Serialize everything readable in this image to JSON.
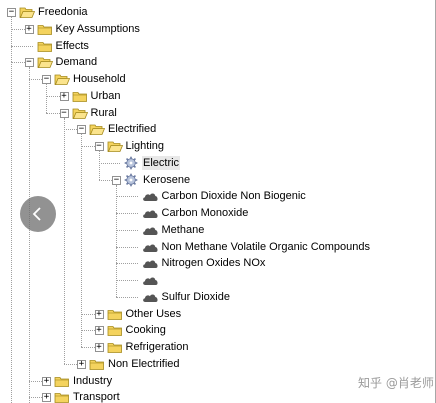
{
  "tree": {
    "nodes": [
      {
        "name": "tree-node-freedonia",
        "label": "Freedonia",
        "depth": 0,
        "row": 0,
        "toggle": "minus",
        "icon": "folder-open-icon"
      },
      {
        "name": "tree-node-key-assumptions",
        "label": "Key Assumptions",
        "depth": 1,
        "row": 1,
        "toggle": "plus",
        "icon": "folder-icon"
      },
      {
        "name": "tree-node-effects",
        "label": "Effects",
        "depth": 1,
        "row": 2,
        "toggle": null,
        "icon": "folder-icon"
      },
      {
        "name": "tree-node-demand",
        "label": "Demand",
        "depth": 1,
        "row": 3,
        "toggle": "minus",
        "icon": "folder-open-icon"
      },
      {
        "name": "tree-node-household",
        "label": "Household",
        "depth": 2,
        "row": 4,
        "toggle": "minus",
        "icon": "folder-open-icon"
      },
      {
        "name": "tree-node-urban",
        "label": "Urban",
        "depth": 3,
        "row": 5,
        "toggle": "plus",
        "icon": "folder-icon"
      },
      {
        "name": "tree-node-rural",
        "label": "Rural",
        "depth": 3,
        "row": 6,
        "toggle": "minus",
        "icon": "folder-open-icon"
      },
      {
        "name": "tree-node-electrified",
        "label": "Electrified",
        "depth": 4,
        "row": 7,
        "toggle": "minus",
        "icon": "folder-open-icon"
      },
      {
        "name": "tree-node-lighting",
        "label": "Lighting",
        "depth": 5,
        "row": 8,
        "toggle": "minus",
        "icon": "folder-open-icon"
      },
      {
        "name": "tree-node-electric",
        "label": "Electric",
        "depth": 6,
        "row": 9,
        "toggle": null,
        "icon": "gear-icon",
        "selected": true
      },
      {
        "name": "tree-node-kerosene",
        "label": "Kerosene",
        "depth": 6,
        "row": 10,
        "toggle": "minus",
        "icon": "gear-icon"
      },
      {
        "name": "tree-node-co2-non-biogenic",
        "label": "Carbon Dioxide Non Biogenic",
        "depth": 7,
        "row": 11,
        "toggle": null,
        "icon": "cloud-icon"
      },
      {
        "name": "tree-node-carbon-monoxide",
        "label": "Carbon Monoxide",
        "depth": 7,
        "row": 12,
        "toggle": null,
        "icon": "cloud-icon"
      },
      {
        "name": "tree-node-methane",
        "label": "Methane",
        "depth": 7,
        "row": 13,
        "toggle": null,
        "icon": "cloud-icon"
      },
      {
        "name": "tree-node-nmvoc",
        "label": "Non Methane Volatile Organic Compounds",
        "depth": 7,
        "row": 14,
        "toggle": null,
        "icon": "cloud-icon"
      },
      {
        "name": "tree-node-nitrogen-oxides",
        "label": "Nitrogen Oxides NOx",
        "depth": 7,
        "row": 15,
        "toggle": null,
        "icon": "cloud-icon"
      },
      {
        "name": "tree-node-unnamed",
        "label": "",
        "depth": 7,
        "row": 16,
        "toggle": null,
        "icon": "cloud-icon"
      },
      {
        "name": "tree-node-sulfur-dioxide",
        "label": "Sulfur Dioxide",
        "depth": 7,
        "row": 17,
        "toggle": null,
        "icon": "cloud-icon"
      },
      {
        "name": "tree-node-other-uses",
        "label": "Other Uses",
        "depth": 5,
        "row": 18,
        "toggle": "plus",
        "icon": "folder-icon"
      },
      {
        "name": "tree-node-cooking",
        "label": "Cooking",
        "depth": 5,
        "row": 19,
        "toggle": "plus",
        "icon": "folder-icon"
      },
      {
        "name": "tree-node-refrigeration",
        "label": "Refrigeration",
        "depth": 5,
        "row": 20,
        "toggle": "plus",
        "icon": "folder-icon"
      },
      {
        "name": "tree-node-non-electrified",
        "label": "Non Electrified",
        "depth": 4,
        "row": 21,
        "toggle": "plus",
        "icon": "folder-icon"
      },
      {
        "name": "tree-node-industry",
        "label": "Industry",
        "depth": 2,
        "row": 22,
        "toggle": "plus",
        "icon": "folder-icon"
      },
      {
        "name": "tree-node-transport",
        "label": "Transport",
        "depth": 2,
        "row": 23,
        "toggle": "plus",
        "icon": "folder-icon"
      }
    ]
  },
  "overlay": {
    "nav_icon": "chevron-left-icon",
    "watermark": "知乎 @肖老师"
  },
  "colors": {
    "folder_fill": "#f4d35e",
    "folder_stroke": "#a58a1d",
    "gear_fill": "#b8c4dc",
    "cloud_fill": "#555555"
  }
}
